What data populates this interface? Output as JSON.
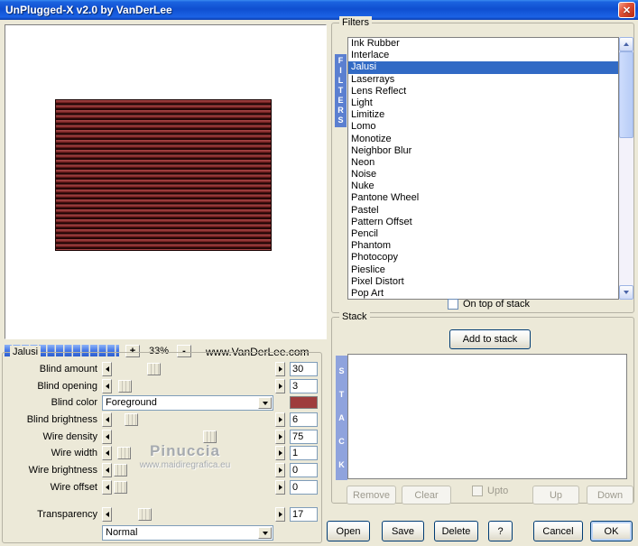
{
  "window": {
    "title": "UnPlugged-X v2.0 by VanDerLee",
    "close_label": "✕"
  },
  "preview": {
    "zoom_in": "+",
    "zoom_level": "33%",
    "zoom_out": "-",
    "website": "www.VanDerLee.com"
  },
  "watermark": {
    "line1": "Pinuccia",
    "line2": "www.maidiregrafica.eu"
  },
  "filters": {
    "group_label": "Filters",
    "vertical_label": "FILTERS",
    "selected": "Jalusi",
    "items": [
      "Ink Rubber",
      "Interlace",
      "Jalusi",
      "Laserrays",
      "Lens Reflect",
      "Light",
      "Limitize",
      "Lomo",
      "Monotize",
      "Neighbor Blur",
      "Neon",
      "Noise",
      "Nuke",
      "Pantone Wheel",
      "Pastel",
      "Pattern Offset",
      "Pencil",
      "Phantom",
      "Photocopy",
      "Pieslice",
      "Pixel Distort",
      "Pop Art"
    ],
    "on_top_label": "On top of stack"
  },
  "params": {
    "group_label": "Jalusi",
    "rows": [
      {
        "label": "Blind amount",
        "value": "30",
        "pos": 21
      },
      {
        "label": "Blind opening",
        "value": "3",
        "pos": 3
      },
      {
        "label": "Blind color",
        "value": "Foreground"
      },
      {
        "label": "Blind brightness",
        "value": "6",
        "pos": 7
      },
      {
        "label": "Wire density",
        "value": "75",
        "pos": 56
      },
      {
        "label": "Wire width",
        "value": "1",
        "pos": 2
      },
      {
        "label": "Wire brightness",
        "value": "0",
        "pos": 0
      },
      {
        "label": "Wire offset",
        "value": "0",
        "pos": 0
      }
    ],
    "transparency": {
      "label": "Transparency",
      "value": "17",
      "pos": 15
    },
    "blend_mode": "Normal"
  },
  "stack": {
    "group_label": "Stack",
    "vertical_label": "STACK",
    "add_button": "Add to stack",
    "remove_button": "Remove",
    "clear_button": "Clear",
    "upto_label": "Upto",
    "up_button": "Up",
    "down_button": "Down"
  },
  "footer": {
    "open": "Open",
    "save": "Save",
    "delete": "Delete",
    "help": "?",
    "cancel": "Cancel",
    "ok": "OK"
  },
  "colors": {
    "selection": "#316ac5",
    "blind_color_swatch": "#9e3c3c"
  }
}
